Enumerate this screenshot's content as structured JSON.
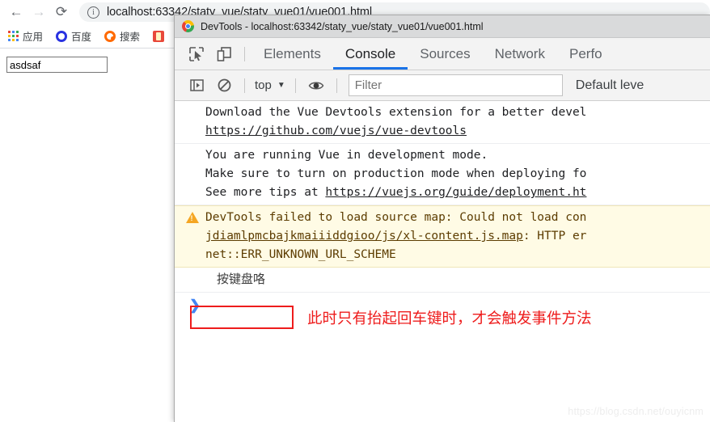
{
  "browser": {
    "nav": {
      "back_label": "←",
      "forward_label": "→",
      "reload_label": "⟳"
    },
    "omnibox": {
      "info_label": "i",
      "url": "localhost:63342/staty_vue/staty_vue01/vue001.html"
    },
    "bookmarks": [
      {
        "label": "应用",
        "icon": "apps-grid-icon"
      },
      {
        "label": "百度",
        "icon": "baidu-paw-icon"
      },
      {
        "label": "搜索",
        "icon": "search-ring-icon"
      },
      {
        "label": "",
        "icon": "red-bookmark-icon"
      }
    ],
    "page": {
      "input_value": "asdsaf",
      "input_placeholder": ""
    }
  },
  "devtools": {
    "title": "DevTools - localhost:63342/staty_vue/staty_vue01/vue001.html",
    "toolbar_icons": [
      {
        "name": "inspect-element-icon"
      },
      {
        "name": "device-toolbar-icon"
      }
    ],
    "tabs": [
      {
        "label": "Elements",
        "active": false
      },
      {
        "label": "Console",
        "active": true
      },
      {
        "label": "Sources",
        "active": false
      },
      {
        "label": "Network",
        "active": false
      },
      {
        "label": "Perfo",
        "active": false
      }
    ],
    "console_toolbar": {
      "sidebar_toggle": "console-sidebar-icon",
      "clear_console": "clear-console-icon",
      "context": "top",
      "context_caret": "▼",
      "eye_icon": "live-expression-icon",
      "filter_placeholder": "Filter",
      "filter_value": "",
      "level": "Default leve"
    },
    "messages": [
      {
        "type": "info",
        "text_before": "Download the Vue Devtools extension for a better devel",
        "link": "https://github.com/vuejs/vue-devtools"
      },
      {
        "type": "info",
        "line1": "You are running Vue in development mode.",
        "line2": "Make sure to turn on production mode when deploying fo",
        "line3_before": "See more tips at ",
        "line3_link": "https://vuejs.org/guide/deployment.ht"
      },
      {
        "type": "warning",
        "line1": "DevTools failed to load source map: Could not load con",
        "line2_link": "jdiamlpmcbajkmaiiiddgioo/js/xl-content.js.map",
        "line2_after": ": HTTP er",
        "line3": "net::ERR_UNKNOWN_URL_SCHEME"
      },
      {
        "type": "log",
        "text": "按键盘咯"
      }
    ],
    "annotation": {
      "text": "此时只有抬起回车键时，才会触发事件方法",
      "color": "#ee1c1c"
    },
    "prompt": {
      "arrow": "❯",
      "value": ""
    }
  },
  "watermark": "https://blog.csdn.net/ouyicnm",
  "colors": {
    "accent_blue": "#1a73e8",
    "warning_bg": "#fffbe5",
    "warning_icon": "#f5a623",
    "annotation_red": "#ee1c1c"
  }
}
